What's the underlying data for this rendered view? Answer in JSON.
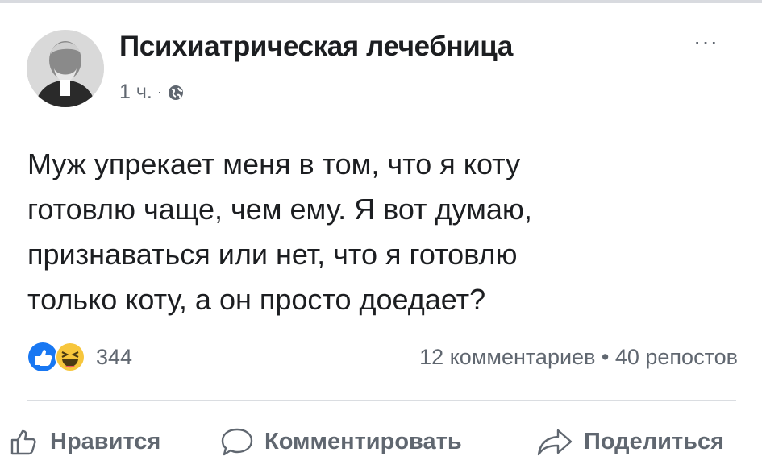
{
  "post": {
    "page_name": "Психиатрическая лечебница",
    "time": "1 ч.",
    "separator": "·",
    "audience_icon": "globe-icon",
    "more_label": "···",
    "text_lines": [
      "Муж упрекает меня в том, что я коту",
      "готовлю чаще, чем ему. Я вот думаю,",
      "признаваться или нет, что я готовлю",
      "только коту, а он просто доедает?"
    ]
  },
  "reactions": {
    "icons": [
      "like-icon",
      "haha-icon"
    ],
    "count": "344"
  },
  "stats": {
    "text": "12 комментариев • 40 репостов"
  },
  "actions": {
    "like": "Нравится",
    "comment": "Комментировать",
    "share": "Поделиться"
  },
  "colors": {
    "like_blue": "#1877f2",
    "haha_yellow": "#f7c63c",
    "secondary_text": "#606770"
  }
}
